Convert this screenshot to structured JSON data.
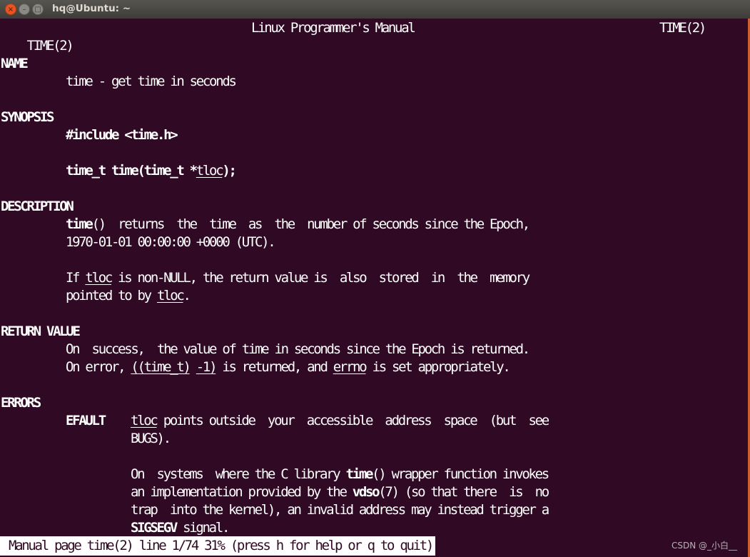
{
  "window": {
    "title": "hq@Ubuntu: ~",
    "buttons": {
      "close": "×",
      "minimize": "–",
      "maximize": "□"
    }
  },
  "colors": {
    "background": "#300a24",
    "text": "#ffffff",
    "accent": "#e95420"
  },
  "man": {
    "header_left": "TIME(2)",
    "header_center": "Linux Programmer's Manual",
    "header_right": "TIME(2)",
    "sections": {
      "name": "NAME",
      "synopsis": "SYNOPSIS",
      "description": "DESCRIPTION",
      "return_value": "RETURN VALUE",
      "errors": "ERRORS"
    },
    "name_line": "time - get time in seconds",
    "synopsis_include": "#include <time.h>",
    "synopsis_proto_a": "time_t time(time_t *",
    "synopsis_proto_arg": "tloc",
    "synopsis_proto_b": ");",
    "desc1_fn": "time",
    "desc1_rest": "()  returns  the  time  as  the  number of seconds since the Epoch,",
    "desc2": "1970-01-01 00:00:00 +0000 (UTC).",
    "desc3_a": "If ",
    "desc3_arg": "tloc",
    "desc3_b": " is non-NULL, the return value is  also  stored  in  the  memory",
    "desc4_a": "pointed to by ",
    "desc4_arg": "tloc",
    "desc4_b": ".",
    "ret1": "On  success,  the value of time in seconds since the Epoch is returned.",
    "ret2_a": "On error, ",
    "ret2_u1": "((time_t)",
    "ret2_sp": " ",
    "ret2_u2": "-1)",
    "ret2_b": " is returned, and ",
    "ret2_u3": "errno",
    "ret2_c": " is set appropriately.",
    "err_code": "EFAULT",
    "err1_arg": "tloc",
    "err1_rest": " points outside  your  accessible  address  space  (but  see",
    "err2": "BUGS).",
    "err3_a": "On  systems  where the C library ",
    "err3_fn": "time",
    "err3_b": "() wrapper function invokes",
    "err4_a": "an implementation provided by the ",
    "err4_fn": "vdso",
    "err4_b": "(7) (so that there  is  no",
    "err5": "trap  into the kernel), an invalid address may instead trigger a",
    "err6_sig": "SIGSEGV",
    "err6_b": " signal."
  },
  "status_bar": {
    "text": "Manual page time(2) line 1/74 31% (press h for help or q to quit)"
  },
  "watermark": "CSDN @_小白__"
}
